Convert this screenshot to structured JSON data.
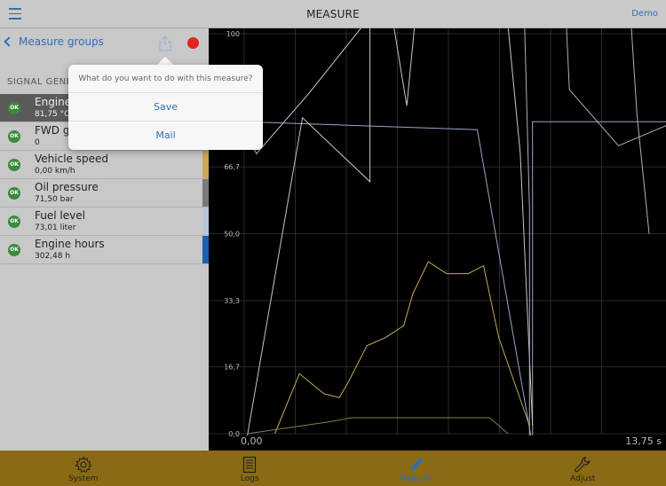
{
  "topbar": {
    "title": "MEASURE",
    "demo_label": "Demo"
  },
  "left_panel": {
    "back_label": "Measure groups",
    "section_label": "SIGNAL GENE",
    "signals": [
      {
        "name": "Engine",
        "value": "81,75 °C",
        "status": "OK",
        "color": "#777777",
        "selected": true
      },
      {
        "name": "FWD g",
        "value": "0",
        "status": "OK",
        "color": "#d8c8a0",
        "selected": false
      },
      {
        "name": "Vehicle speed",
        "value": "0,00 km/h",
        "status": "OK",
        "color": "#c9a85a",
        "selected": false
      },
      {
        "name": "Oil pressure",
        "value": "71,50 bar",
        "status": "OK",
        "color": "#7a7a7a",
        "selected": false
      },
      {
        "name": "Fuel level",
        "value": "73,01 liter",
        "status": "OK",
        "color": "#b8c4d8",
        "selected": false
      },
      {
        "name": "Engine hours",
        "value": "302,48 h",
        "status": "OK",
        "color": "#1d5fb0",
        "selected": false
      }
    ]
  },
  "popover": {
    "question": "What do you want to do with this measure?",
    "options": [
      "Save",
      "Mail"
    ]
  },
  "chart_data": {
    "type": "line",
    "ylim": [
      0,
      100
    ],
    "y_ticks": [
      "100",
      "66,7",
      "50,0",
      "33,3",
      "16,7",
      "0,0"
    ],
    "x_start_label": "0,00",
    "x_end_label": "13,75 s",
    "x_range": [
      0,
      13.75
    ],
    "grid": true,
    "series": [
      {
        "color": "#c8c8c8",
        "points": [
          [
            0,
            76
          ],
          [
            0.4,
            70
          ],
          [
            2.1,
            85
          ],
          [
            4.7,
            110
          ],
          [
            5.3,
            82
          ],
          [
            6.8,
            200
          ]
        ]
      },
      {
        "color": "#9aa8c8",
        "points": [
          [
            0,
            78
          ],
          [
            7.6,
            76
          ],
          [
            9.4,
            -3
          ],
          [
            9.4,
            78
          ],
          [
            13.75,
            78
          ]
        ]
      },
      {
        "color": "#c8c8c8",
        "points": [
          [
            0,
            -5
          ],
          [
            1.9,
            79
          ],
          [
            4.1,
            63
          ],
          [
            4.1,
            200
          ]
        ]
      },
      {
        "color": "#c8c8c8",
        "points": [
          [
            7.6,
            200
          ],
          [
            8.5,
            110
          ],
          [
            9.0,
            70
          ],
          [
            9.4,
            2
          ]
        ]
      },
      {
        "color": "#b0b0b0",
        "points": [
          [
            9.4,
            200
          ],
          [
            10.0,
            108
          ],
          [
            12.4,
            128
          ],
          [
            12.8,
            80
          ],
          [
            13.2,
            50
          ]
        ]
      },
      {
        "color": "#b0b0b0",
        "points": [
          [
            9.9,
            200
          ],
          [
            10.6,
            86
          ],
          [
            12.2,
            72
          ],
          [
            13.75,
            77
          ]
        ]
      },
      {
        "color": "#b0b0b0",
        "points": [
          [
            8.8,
            200
          ],
          [
            9.3,
            56
          ],
          [
            9.3,
            -2
          ]
        ]
      },
      {
        "color": "#c9a85a",
        "points": [
          [
            1.0,
            0
          ],
          [
            1.8,
            15
          ],
          [
            2.6,
            10
          ],
          [
            3.1,
            9
          ],
          [
            3.4,
            13
          ],
          [
            4.0,
            22
          ],
          [
            4.6,
            24
          ],
          [
            5.2,
            27
          ],
          [
            5.5,
            35
          ],
          [
            6.0,
            43
          ],
          [
            6.6,
            40
          ],
          [
            7.3,
            40
          ],
          [
            7.8,
            42
          ],
          [
            8.3,
            24
          ],
          [
            9.3,
            2
          ]
        ]
      },
      {
        "color": "#8a7a5a",
        "points": [
          [
            0.1,
            0
          ],
          [
            2.8,
            3
          ],
          [
            3.5,
            4
          ],
          [
            6.3,
            4
          ],
          [
            8.0,
            4
          ],
          [
            8.6,
            0
          ]
        ]
      }
    ]
  },
  "tabs": [
    {
      "label": "System",
      "icon": "gear-icon",
      "active": false
    },
    {
      "label": "Logs",
      "icon": "document-icon",
      "active": false
    },
    {
      "label": "Measure",
      "icon": "pen-icon",
      "active": true
    },
    {
      "label": "Adjust",
      "icon": "wrench-icon",
      "active": false
    }
  ]
}
